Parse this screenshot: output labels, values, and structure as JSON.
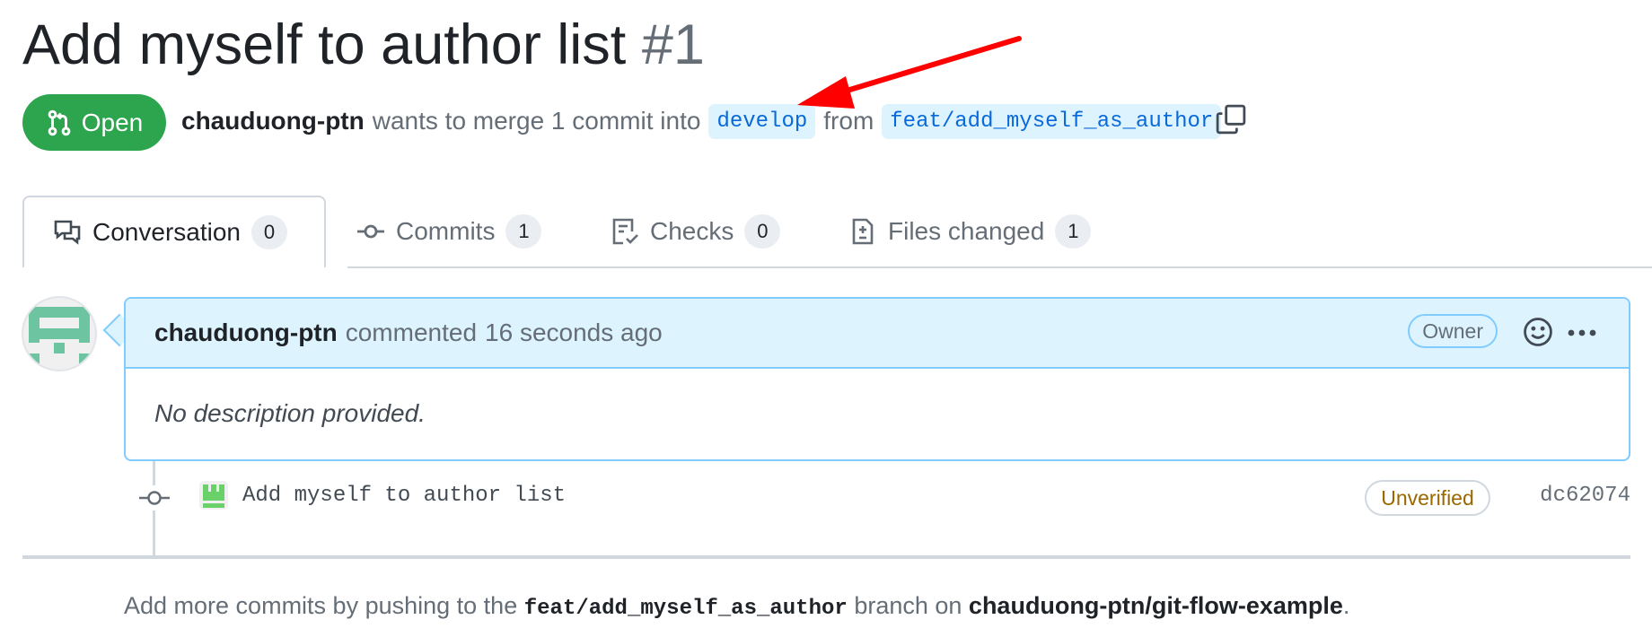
{
  "pr": {
    "title": "Add myself to author list",
    "number": "#1",
    "state": "Open",
    "author": "chauduong-ptn",
    "merge_text_1": "wants to merge 1 commit into",
    "base_branch": "develop",
    "merge_text_2": "from",
    "head_branch": "feat/add_myself_as_author"
  },
  "tabs": [
    {
      "label": "Conversation",
      "count": "0",
      "icon": "comment-discussion-icon"
    },
    {
      "label": "Commits",
      "count": "1",
      "icon": "git-commit-icon"
    },
    {
      "label": "Checks",
      "count": "0",
      "icon": "checklist-icon"
    },
    {
      "label": "Files changed",
      "count": "1",
      "icon": "file-diff-icon"
    }
  ],
  "comment": {
    "author": "chauduong-ptn",
    "action": "commented",
    "time": "16 seconds ago",
    "role_badge": "Owner",
    "body": "No description provided."
  },
  "commit": {
    "message": "Add myself to author list",
    "verification": "Unverified",
    "sha": "dc62074"
  },
  "footer": {
    "text_1": "Add more commits by pushing to the",
    "branch": "feat/add_myself_as_author",
    "text_2": "branch on",
    "repo": "chauduong-ptn/git-flow-example",
    "period": "."
  },
  "colors": {
    "open_green": "#2da44e",
    "accent_blue": "#0969da",
    "annotation_arrow": "#ff0000"
  }
}
